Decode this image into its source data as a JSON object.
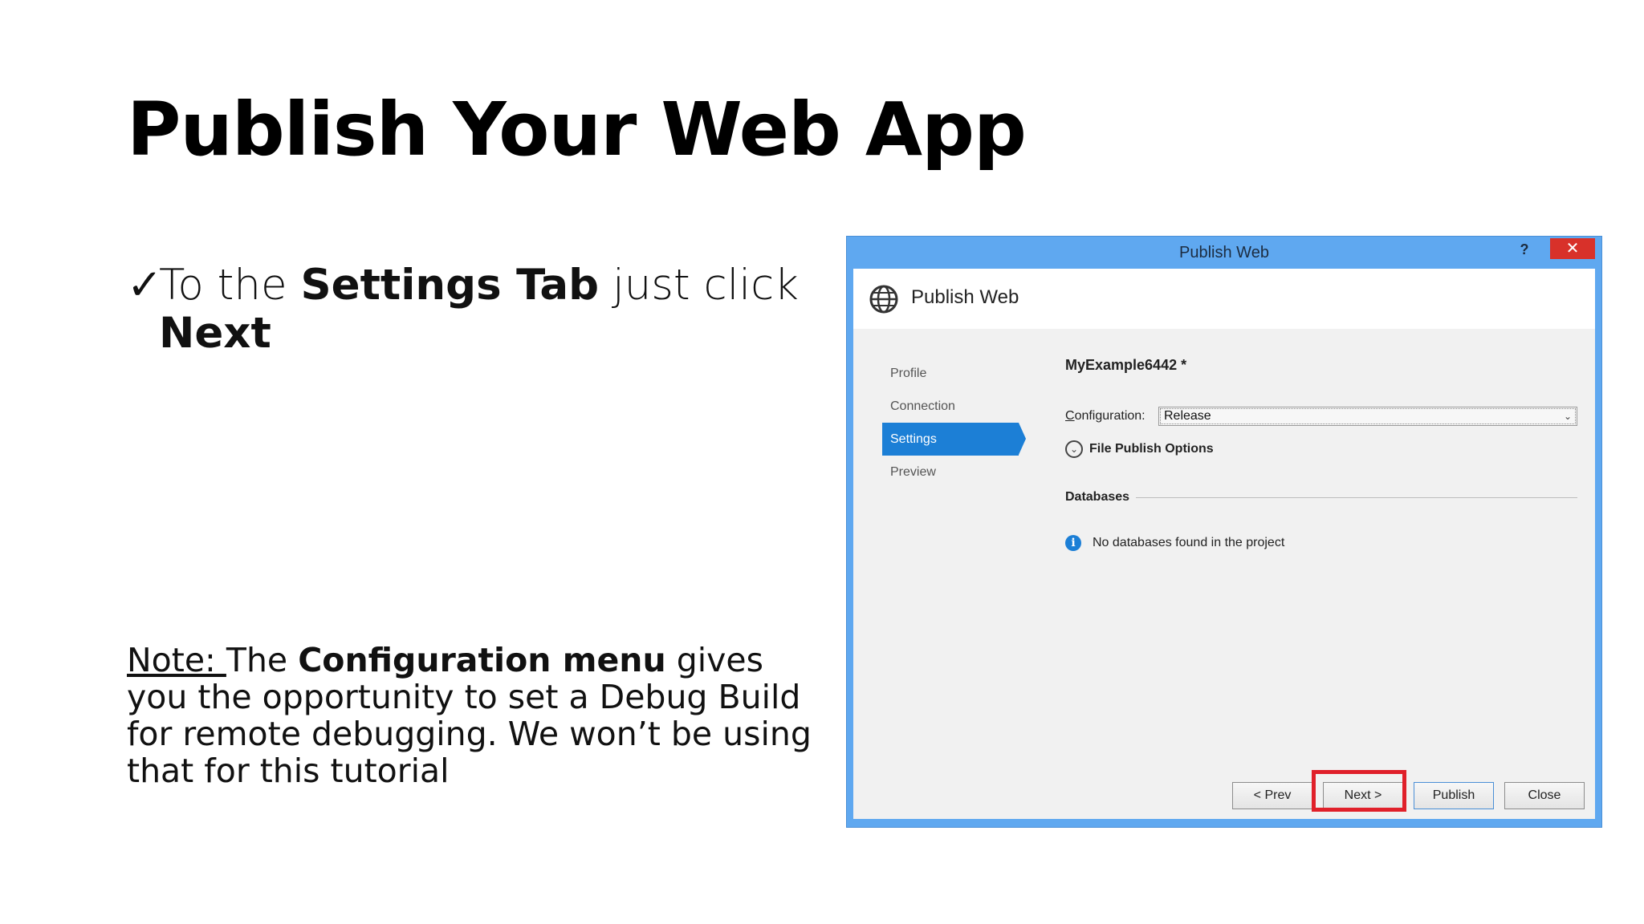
{
  "slide": {
    "title": "Publish Your Web App",
    "bullet": {
      "check": "✓",
      "pre": "To the ",
      "bold1": "Settings Tab",
      "mid": " just click",
      "bold2": "Next"
    },
    "note": {
      "underlined": "Note: ",
      "t1": "The ",
      "b1": "Configuration menu",
      "t2": " gives you the opportunity to set a ",
      "m1": "Debug Build",
      "t3": " for ",
      "m2": "remote debugging",
      "t4": ". We won’t be using that for this tutorial"
    }
  },
  "dialog": {
    "window_title": "Publish Web",
    "help_label": "?",
    "close_label": "✕",
    "header_title": "Publish Web",
    "nav": [
      {
        "label": "Profile"
      },
      {
        "label": "Connection"
      },
      {
        "label": "Settings",
        "active": true
      },
      {
        "label": "Preview"
      }
    ],
    "profile_name": "MyExample6442 *",
    "configuration": {
      "label_first": "C",
      "label_rest": "onfiguration:",
      "value": "Release"
    },
    "file_publish_options": "File Publish Options",
    "databases_label": "Databases",
    "no_db_message": "No databases found in the project",
    "buttons": {
      "prev": "< Prev",
      "next": "Next >",
      "publish": "Publish",
      "close": "Close"
    }
  },
  "colors": {
    "accent": "#1c7fd6",
    "titlebar": "#5fa8f0",
    "close": "#d8312a",
    "highlight": "#e0202a"
  }
}
